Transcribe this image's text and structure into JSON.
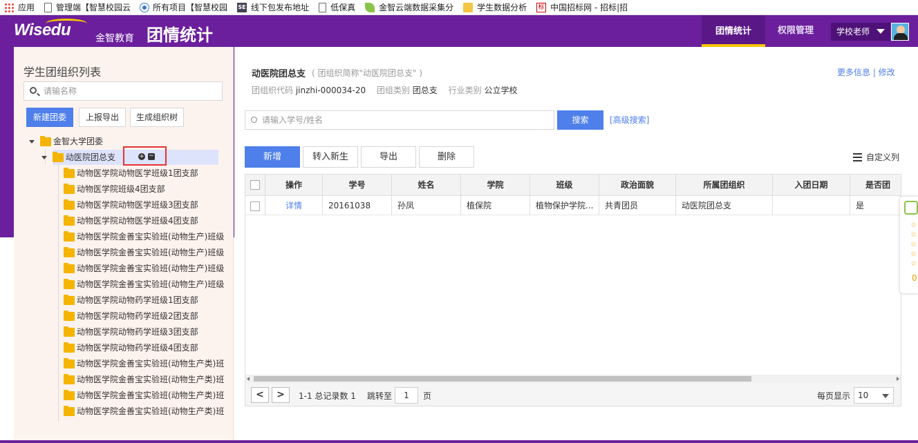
{
  "bookmarks": [
    {
      "label": "应用",
      "icon": "apps-icon"
    },
    {
      "label": "管理端【智慧校园云",
      "icon": "page-icon"
    },
    {
      "label": "所有项目【智慧校园",
      "icon": "c-icon"
    },
    {
      "label": "线下包发布地址",
      "icon": "se-icon"
    },
    {
      "label": "低保真",
      "icon": "page-icon"
    },
    {
      "label": "金智云端数据采集分",
      "icon": "leaf-icon"
    },
    {
      "label": "学生数据分析",
      "icon": "folder-icon"
    },
    {
      "label": "中国招标网 - 招标|招",
      "icon": "biao-icon"
    }
  ],
  "header": {
    "logo_text": "Wisedu",
    "logo_cn": "金智教育",
    "app_title": "团情统计",
    "nav": [
      "团情统计",
      "权限管理"
    ],
    "active_nav": "团情统计",
    "user": "学校老师"
  },
  "left": {
    "title": "学生团组织列表",
    "search_placeholder": "请输名称",
    "buttons": [
      "新建团委",
      "上报导出",
      "生成组织树"
    ],
    "root": "金智大学团委",
    "selected": "动医院团总支",
    "plus_glyph": "+",
    "minus_glyph": "−",
    "children": [
      "动物医学院动物医学班级1团支部",
      "动物医学院班级4团支部",
      "动物医学院动物医学班级3团支部",
      "动物医学院动物医学班级4团支部",
      "动物医学院金善宝实验班(动物生产)班级",
      "动物医学院金善宝实验班(动物生产)班级",
      "动物医学院金善宝实验班(动物生产)班级",
      "动物医学院金善宝实验班(动物生产)班级",
      "动物医学院动物药学班级1团支部",
      "动物医学院动物药学班级2团支部",
      "动物医学院动物药学班级3团支部",
      "动物医学院动物药学班级4团支部",
      "动物医学院金善宝实验班(动物生产类)班",
      "动物医学院金善宝实验班(动物生产类)班",
      "动物医学院金善宝实验班(动物生产类)班",
      "动物医学院金善宝实验班(动物生产类)班"
    ]
  },
  "main": {
    "org_name": "动医院团总支",
    "org_short": "( 团组织简称\"动医院团总支\" )",
    "meta": [
      {
        "label": "团组织代码",
        "value": "jinzhi-000034-20"
      },
      {
        "label": "团组类别",
        "value": "团总支"
      },
      {
        "label": "行业类别",
        "value": "公立学校"
      }
    ],
    "more_link": "更多信息 | 修改",
    "search_placeholder": "请输入学号/姓名",
    "search_button": "搜索",
    "advanced": "[高级搜索]",
    "toolbar": [
      "新增",
      "转入新生",
      "导出",
      "删除"
    ],
    "custom_columns": "自定义列",
    "columns": [
      "操作",
      "学号",
      "姓名",
      "学院",
      "班级",
      "政治面貌",
      "所属团组织",
      "入团日期",
      "是否团"
    ],
    "rows": [
      [
        "详情",
        "20161038",
        "孙凤",
        "植保院",
        "植物保护学院...",
        "共青团员",
        "动医院团总支",
        "",
        "是"
      ]
    ],
    "pager": {
      "prev": "<",
      "next": ">",
      "summary": "1-1 总记录数 1",
      "jump_label": "跳转至",
      "page": "1",
      "page_unit": "页",
      "per_page_label": "每页显示",
      "per_page": "10"
    }
  },
  "widget": {
    "stars": [
      "☆",
      "☆",
      "☆",
      "☆",
      "☆"
    ],
    "count": "0"
  },
  "colors": {
    "header_purple": "#6b1f9c",
    "accent_blue": "#4e7fea",
    "active_underline": "#f5c400",
    "left_panel_bg": "#fdf3ee",
    "highlight_red": "#e53333"
  }
}
